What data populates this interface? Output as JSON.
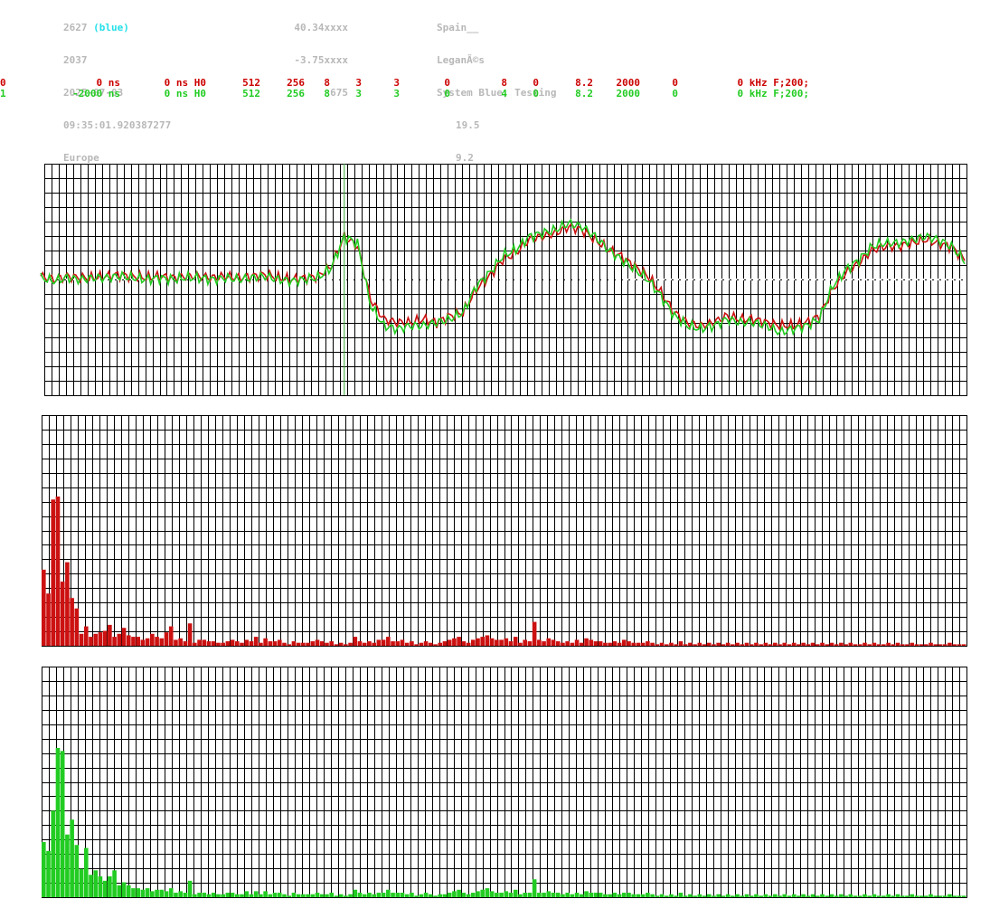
{
  "header": {
    "col1": [
      "2627",
      "2037",
      "2025-07-03",
      "09:35:01.920387277",
      "Europe"
    ],
    "col1_suffix": " (blue)",
    "col2": [
      "40.34xxxx",
      "-3.75xxxx",
      "675"
    ],
    "col3": [
      "Spain__",
      "LeganÃ©s",
      "System Blue, Testing",
      "19.5",
      "9.2"
    ]
  },
  "channels": [
    {
      "id": "0",
      "fields": [
        "0 ns",
        "0 ns H0",
        "512",
        "256",
        "8",
        "3",
        "3",
        "0",
        "8",
        "0",
        "8.2",
        "2000",
        "0",
        "0 kHz F;200;"
      ],
      "color": "#cc0000"
    },
    {
      "id": "1",
      "fields": [
        "-2000 ns",
        "0 ns H0",
        "512",
        "256",
        "8",
        "3",
        "3",
        "0",
        "4",
        "0",
        "8.2",
        "2000",
        "0",
        "0 kHz F;200;"
      ],
      "color": "#22cc22"
    }
  ],
  "colors": {
    "grid": "#000000",
    "red": "#cc1111",
    "green": "#22cc22",
    "marker": "#33aa33"
  },
  "chart_data": [
    {
      "type": "line",
      "series": [
        {
          "values": [
            0.1,
            0.0,
            0.1,
            0.05,
            0.05,
            0.1,
            0.15,
            0.1,
            0.05,
            0.1,
            0.05,
            0.1,
            0.1,
            0.05,
            0.1,
            0.05,
            0.1,
            0.15,
            0.05,
            0.0,
            0.05,
            0.1,
            0.4,
            1.3,
            1.0,
            -0.6,
            -1.2,
            -1.3,
            -1.3,
            -1.2,
            -1.3,
            -1.1,
            -1.0,
            -0.3,
            0.1,
            0.6,
            0.8,
            1.2,
            1.3,
            1.4,
            1.6,
            1.5,
            1.2,
            0.9,
            0.7,
            0.4,
            0.1,
            -0.4,
            -1.0,
            -1.3,
            -1.4,
            -1.3,
            -1.1,
            -1.2,
            -1.2,
            -1.3,
            -1.4,
            -1.4,
            -1.3,
            -1.1,
            -0.3,
            0.2,
            0.5,
            0.9,
            1.0,
            1.0,
            1.1,
            1.2,
            1.1,
            1.0,
            0.6
          ]
        },
        {
          "values": [
            0.05,
            -0.05,
            0.05,
            0.0,
            0.05,
            0.05,
            0.1,
            0.05,
            0.0,
            0.05,
            0.0,
            0.05,
            0.05,
            0.0,
            0.05,
            0.0,
            0.05,
            0.1,
            0.0,
            -0.05,
            0.0,
            0.05,
            0.35,
            1.3,
            1.1,
            -0.8,
            -1.4,
            -1.5,
            -1.4,
            -1.4,
            -1.3,
            -1.2,
            -1.0,
            -0.2,
            0.2,
            0.7,
            0.9,
            1.3,
            1.4,
            1.5,
            1.7,
            1.6,
            1.3,
            0.9,
            0.6,
            0.3,
            0.0,
            -0.5,
            -1.1,
            -1.4,
            -1.5,
            -1.4,
            -1.2,
            -1.3,
            -1.3,
            -1.4,
            -1.6,
            -1.5,
            -1.4,
            -1.2,
            -0.2,
            0.3,
            0.6,
            1.0,
            1.1,
            1.1,
            1.2,
            1.3,
            1.2,
            1.0,
            0.55
          ]
        }
      ],
      "ylim": [
        -3.5,
        3.5
      ],
      "marker_index": 23
    },
    {
      "type": "bar",
      "values": [
        51,
        35,
        98,
        100,
        43,
        56,
        32,
        25,
        8,
        13,
        6,
        8,
        9,
        10,
        14,
        6,
        8,
        12,
        7,
        6,
        6,
        4,
        5,
        8,
        6,
        5,
        9,
        13,
        4,
        5,
        3,
        15,
        2,
        4,
        4,
        3,
        3,
        2,
        2,
        3,
        4,
        3,
        2,
        4,
        3,
        6,
        2,
        5,
        3,
        3,
        4,
        2,
        1,
        3,
        2,
        2,
        2,
        3,
        4,
        3,
        2,
        3,
        1,
        2,
        1,
        2,
        6,
        3,
        2,
        3,
        2,
        4,
        4,
        6,
        3,
        3,
        4,
        2,
        3,
        1,
        2,
        3,
        2,
        1,
        2,
        3,
        4,
        5,
        6,
        3,
        2,
        4,
        5,
        6,
        7,
        5,
        4,
        4,
        5,
        3,
        6,
        2,
        4,
        3,
        16,
        4,
        3,
        5,
        4,
        3,
        2,
        3,
        2,
        4,
        2,
        5,
        4,
        3,
        3,
        2,
        2,
        3,
        2,
        4,
        3,
        2,
        2,
        2,
        3,
        2,
        1,
        2,
        1,
        2,
        1,
        3,
        1,
        2,
        1,
        2,
        1,
        2,
        1,
        2,
        1,
        2,
        1,
        2,
        1,
        2,
        1,
        2,
        1,
        2,
        1,
        2,
        1,
        2,
        1,
        2,
        1,
        2,
        1,
        2,
        1,
        2,
        1,
        2,
        1,
        2,
        1,
        2,
        1,
        1,
        2,
        1,
        2,
        1,
        1,
        2,
        1,
        2,
        1,
        1,
        2,
        1,
        1,
        1,
        2,
        1,
        1,
        1,
        2,
        1,
        1,
        1
      ],
      "ylim": [
        0,
        100
      ]
    },
    {
      "type": "bar",
      "values": [
        37,
        31,
        58,
        100,
        98,
        42,
        52,
        35,
        19,
        33,
        15,
        18,
        14,
        11,
        14,
        18,
        8,
        10,
        8,
        6,
        6,
        5,
        6,
        4,
        5,
        5,
        4,
        6,
        3,
        4,
        3,
        11,
        2,
        3,
        3,
        2,
        3,
        2,
        2,
        3,
        3,
        2,
        2,
        4,
        2,
        4,
        2,
        4,
        2,
        3,
        3,
        2,
        1,
        3,
        2,
        2,
        2,
        2,
        3,
        2,
        2,
        3,
        1,
        2,
        1,
        2,
        5,
        3,
        2,
        3,
        2,
        3,
        3,
        5,
        3,
        3,
        3,
        2,
        3,
        1,
        2,
        3,
        2,
        1,
        2,
        2,
        3,
        4,
        5,
        3,
        2,
        3,
        4,
        5,
        6,
        4,
        3,
        3,
        4,
        3,
        5,
        2,
        3,
        3,
        12,
        3,
        3,
        4,
        3,
        3,
        2,
        3,
        2,
        3,
        2,
        4,
        3,
        3,
        3,
        2,
        2,
        3,
        2,
        3,
        3,
        2,
        2,
        2,
        3,
        2,
        1,
        2,
        1,
        2,
        1,
        3,
        1,
        2,
        1,
        2,
        1,
        2,
        1,
        2,
        1,
        2,
        1,
        2,
        1,
        2,
        1,
        2,
        1,
        2,
        1,
        2,
        1,
        2,
        1,
        2,
        1,
        2,
        1,
        2,
        1,
        2,
        1,
        2,
        1,
        2,
        1,
        2,
        1,
        1,
        2,
        1,
        2,
        1,
        1,
        2,
        1,
        2,
        1,
        1,
        2,
        1,
        1,
        1,
        2,
        1,
        1,
        1,
        2,
        1,
        1,
        1
      ],
      "ylim": [
        0,
        100
      ]
    }
  ]
}
